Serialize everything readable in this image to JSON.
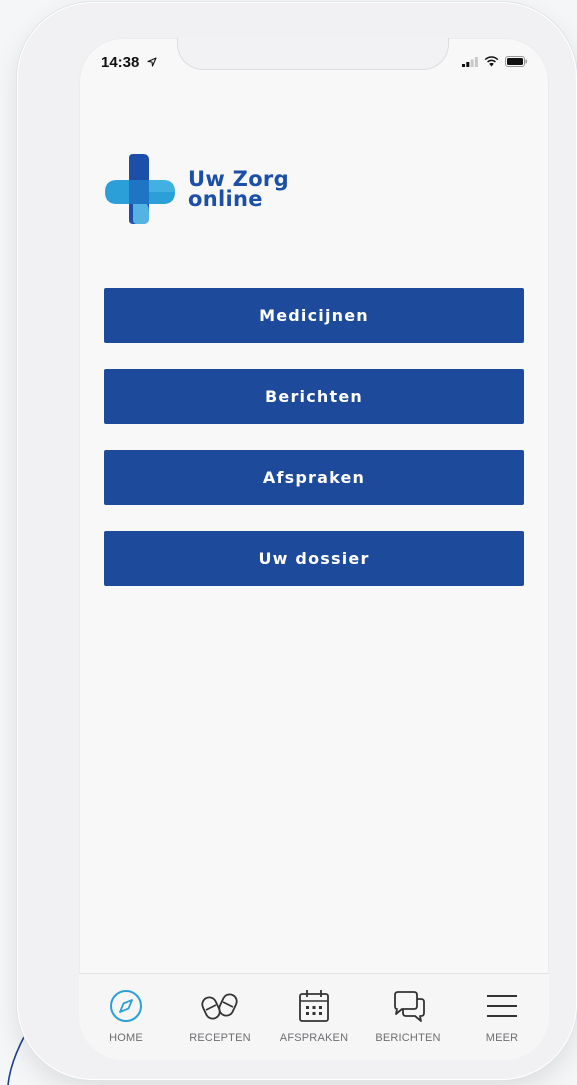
{
  "status_bar": {
    "time": "14:38"
  },
  "logo": {
    "line1": "Uw Zorg",
    "line2": "online"
  },
  "menu": [
    {
      "label": "Medicijnen"
    },
    {
      "label": "Berichten"
    },
    {
      "label": "Afspraken"
    },
    {
      "label": "Uw dossier"
    }
  ],
  "tabbar": [
    {
      "label": "HOME",
      "icon": "compass-icon",
      "active": true
    },
    {
      "label": "RECEPTEN",
      "icon": "pills-icon",
      "active": false
    },
    {
      "label": "AFSPRAKEN",
      "icon": "calendar-icon",
      "active": false
    },
    {
      "label": "BERICHTEN",
      "icon": "chat-bubbles-icon",
      "active": false
    },
    {
      "label": "MEER",
      "icon": "hamburger-menu-icon",
      "active": false
    }
  ],
  "colors": {
    "brand_blue": "#1d4a9a",
    "logo_blue": "#1b4fa8",
    "accent_cyan": "#2a9fd8",
    "tab_inactive": "#6e6e72"
  }
}
